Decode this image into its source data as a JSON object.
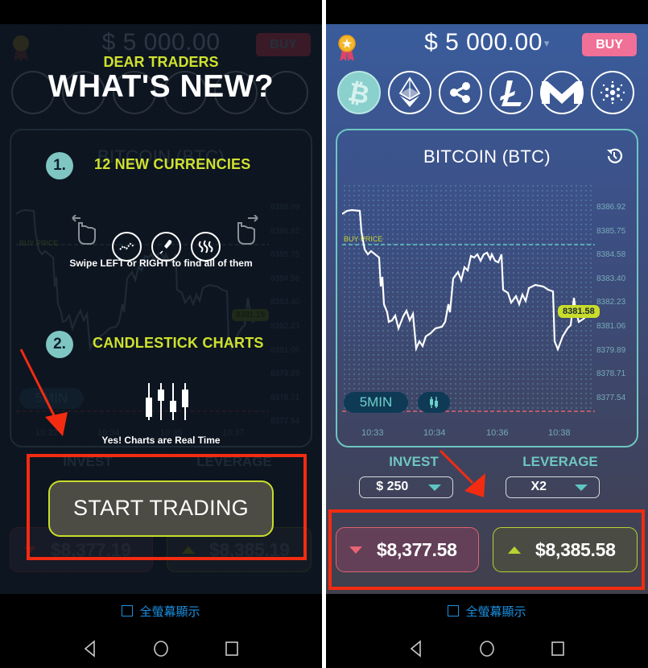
{
  "screens": {
    "right": {
      "header": {
        "balance": "$ 5 000.00",
        "balance_caret": "▾",
        "buy_label": "BUY",
        "badge_icon": "award-medal-icon"
      },
      "coins": [
        {
          "name": "bitcoin",
          "icon": "bitcoin-icon",
          "active": true
        },
        {
          "name": "ethereum",
          "icon": "ethereum-icon",
          "active": false
        },
        {
          "name": "ripple",
          "icon": "ripple-icon",
          "active": false
        },
        {
          "name": "litecoin",
          "icon": "litecoin-icon",
          "active": false
        },
        {
          "name": "monero",
          "icon": "monero-icon",
          "active": false
        },
        {
          "name": "cardano",
          "icon": "cardano-icon",
          "active": false
        }
      ],
      "chart": {
        "title": "BITCOIN (BTC)",
        "buy_price_label": "BUY PRICE",
        "current_price_label": "8381.58",
        "timeframe_label": "5MIN",
        "y_ticks": [
          "8386.92",
          "8385.75",
          "8384.58",
          "8383.40",
          "8382.23",
          "8381.06",
          "8379.89",
          "8378.71",
          "8377.54"
        ],
        "x_ticks": [
          "10:33",
          "10:34",
          "10:36",
          "10:38"
        ]
      },
      "invest": {
        "label": "INVEST",
        "value": "$ 250"
      },
      "leverage": {
        "label": "LEVERAGE",
        "value": "X2"
      },
      "sell_price": "$8,377.58",
      "buy_price": "$8,385.58"
    },
    "left": {
      "header": {
        "balance": "$ 5 000.00",
        "buy_label": "BUY"
      },
      "chart": {
        "title": "BITCOIN (BTC)",
        "buy_price_label": "BUY PRICE",
        "current_price_label": "8381.19",
        "timeframe_label": "5MIN",
        "y_ticks": [
          "8388.09",
          "8386.92",
          "8385.75",
          "8384.58",
          "8383.40",
          "8382.23",
          "8381.06",
          "8379.89",
          "8378.71",
          "8377.54"
        ],
        "x_ticks": [
          "10:32",
          "10:34",
          "10:35",
          "10:37"
        ]
      },
      "invest_label": "INVEST",
      "leverage_label": "LEVERAGE",
      "sell_price": "$8,377.19",
      "buy_price": "$8,385.19",
      "overlay": {
        "kicker": "DEAR TRADERS",
        "headline": "WHAT'S NEW?",
        "step1_number": "1.",
        "step1_title": "12 NEW CURRENCIES",
        "step1_caption": "Swipe LEFT or RIGHT to find all of them",
        "step2_number": "2.",
        "step2_title": "CANDLESTICK CHARTS",
        "step2_caption": "Yes!  Charts are Real Time",
        "cta_label": "START TRADING"
      }
    }
  },
  "system": {
    "fullscreen_label": "全螢幕顯示",
    "nav": [
      "back",
      "home",
      "recents"
    ]
  },
  "colors": {
    "accent_teal": "#6fc6c1",
    "accent_lime": "#cfe12e",
    "buy_pink": "#f07097",
    "sell_red": "#e0636e",
    "annotation_red": "#f32b11",
    "fullscreen_blue": "#1b8fe0"
  }
}
